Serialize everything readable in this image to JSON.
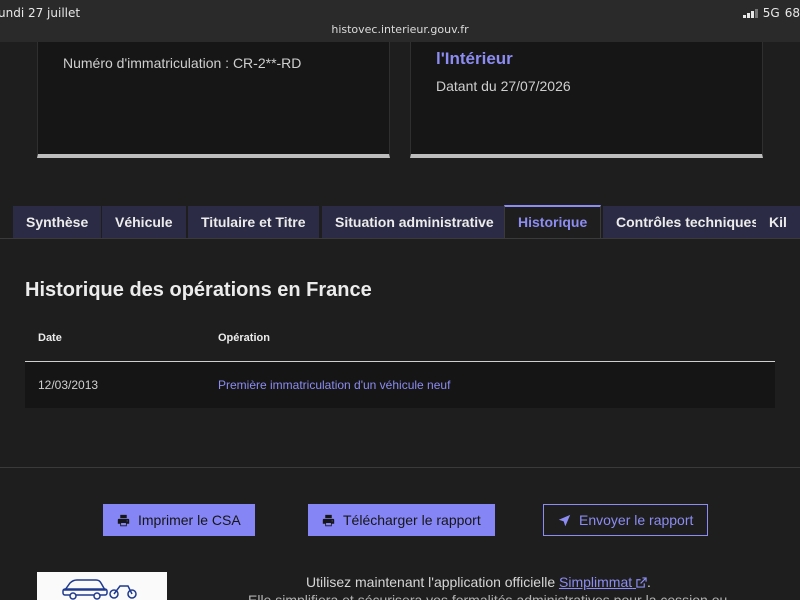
{
  "statusbar": {
    "date": "undi 27 juillet",
    "network": "5G",
    "battery": "68"
  },
  "browser": {
    "url": "histovec.interieur.gouv.fr"
  },
  "cards": {
    "left": {
      "plate_text": "Numéro d'immatriculation : CR-2**-RD"
    },
    "right": {
      "ministry_text": "l'Intérieur",
      "dating_text": "Datant du 27/07/2026"
    }
  },
  "tabs": [
    {
      "label": "Synthèse"
    },
    {
      "label": "Véhicule"
    },
    {
      "label": "Titulaire et Titre"
    },
    {
      "label": "Situation administrative"
    },
    {
      "label": "Historique"
    },
    {
      "label": "Contrôles techniques"
    },
    {
      "label": "Kil"
    }
  ],
  "active_tab": "Historique",
  "history": {
    "title": "Historique des opérations en France",
    "columns": {
      "date": "Date",
      "operation": "Opération"
    },
    "rows": [
      {
        "date": "12/03/2013",
        "operation": "Première immatriculation d'un véhicule neuf"
      }
    ]
  },
  "actions": {
    "print": "Imprimer le CSA",
    "download": "Télécharger le rapport",
    "send": "Envoyer le rapport"
  },
  "promo": {
    "line1_before": "Utilisez maintenant l'application officielle",
    "link": "Simplimmat",
    "line1_after": ".",
    "line2": "Elle simplifiera et sécurisera vos formalités administratives pour la cession ou"
  },
  "colors": {
    "accent": "#8c8cf2",
    "button": "#8585f6",
    "tab_bg": "#2b2b45",
    "background": "#1e1e1e"
  },
  "icons": {
    "print": "printer-icon",
    "download": "printer-icon",
    "send": "send-arrow-icon",
    "external": "external-link-icon"
  }
}
